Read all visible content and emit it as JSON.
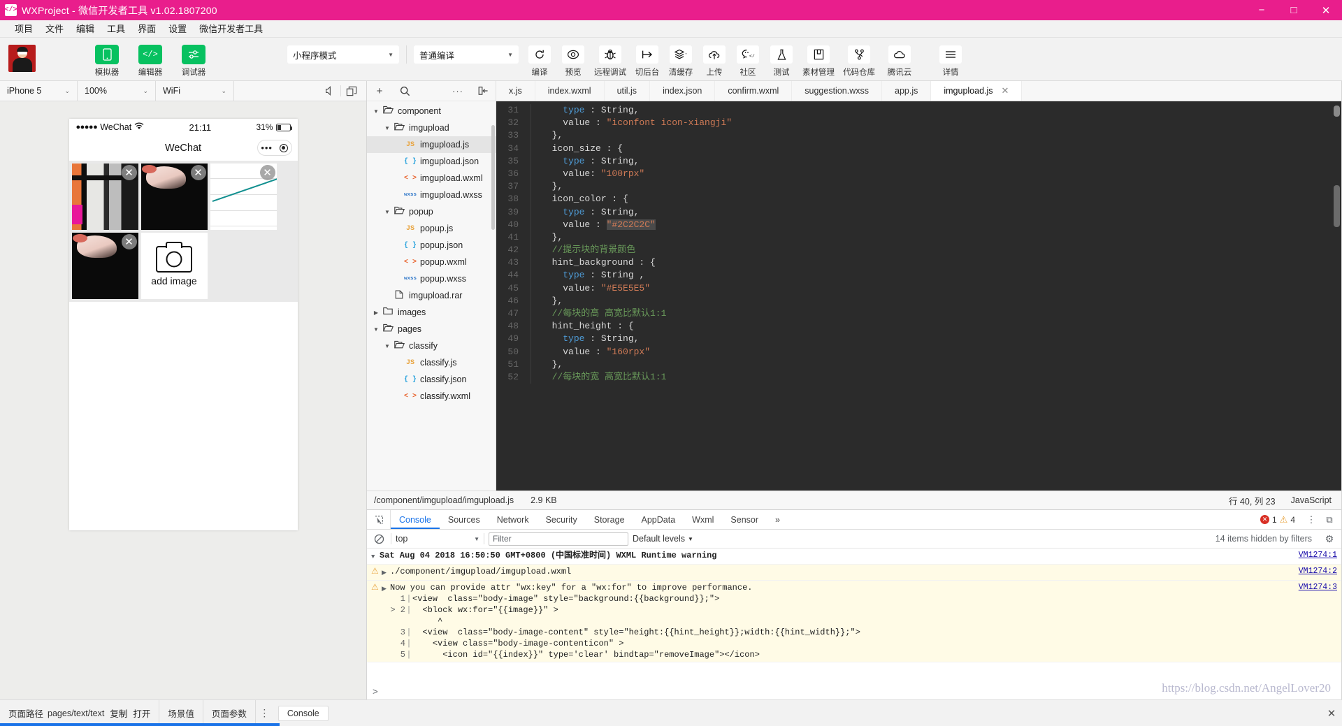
{
  "titlebar": {
    "logo": "code-icon",
    "title": "WXProject - 微信开发者工具 v1.02.1807200",
    "minimize": "−",
    "maximize": "□",
    "close": "✕"
  },
  "menubar": {
    "items": [
      "项目",
      "文件",
      "编辑",
      "工具",
      "界面",
      "设置",
      "微信开发者工具"
    ]
  },
  "toolbar": {
    "modes": [
      {
        "label": "模拟器",
        "icon": "phone-icon",
        "glyph": "▯"
      },
      {
        "label": "编辑器",
        "icon": "code-icon",
        "glyph": "</>"
      },
      {
        "label": "调试器",
        "icon": "debugger-icon",
        "glyph": "⚟"
      }
    ],
    "project_mode": "小程序模式",
    "compile_mode": "普通编译",
    "actions": [
      {
        "label": "编译",
        "icon": "refresh-icon",
        "glyph": "↻"
      },
      {
        "label": "预览",
        "icon": "eye-icon",
        "glyph": "◎"
      },
      {
        "label": "远程调试",
        "icon": "bug-icon",
        "glyph": "🐞"
      },
      {
        "label": "切后台",
        "icon": "background-icon",
        "glyph": "↦"
      },
      {
        "label": "清缓存",
        "icon": "layers-icon",
        "glyph": "≋",
        "caret": "▾"
      },
      {
        "label": "上传",
        "icon": "cloud-upload-icon",
        "glyph": "☁"
      },
      {
        "label": "社区",
        "icon": "community-icon",
        "glyph": "☺"
      },
      {
        "label": "测试",
        "icon": "flask-icon",
        "glyph": "⚗"
      },
      {
        "label": "素材管理",
        "icon": "assets-icon",
        "glyph": "▤"
      },
      {
        "label": "代码仓库",
        "icon": "repo-icon",
        "glyph": "⑂"
      },
      {
        "label": "腾讯云",
        "icon": "tencent-cloud-icon",
        "glyph": "☁"
      },
      {
        "label": "详情",
        "icon": "details-icon",
        "glyph": "☰"
      }
    ]
  },
  "simulator": {
    "device": "iPhone 5",
    "zoom": "100%",
    "network": "WiFi",
    "icons": [
      "volume-icon",
      "rotate-icon"
    ],
    "phone": {
      "signal_dots": "●●●●●",
      "carrier": "WeChat",
      "wifi": "⌁",
      "time": "21:11",
      "battery_text": "31%",
      "nav_title": "WeChat",
      "cap_dots": "•••",
      "add_image_label": "add image",
      "cells": [
        {
          "type": "ct",
          "close": "✕"
        },
        {
          "type": "dark",
          "close": "✕"
        },
        {
          "type": "chart",
          "close": "✕"
        },
        {
          "type": "dark",
          "close": "✕"
        },
        {
          "type": "add",
          "close": ""
        }
      ]
    }
  },
  "filetree": {
    "header_icons": [
      "add-icon",
      "search-icon",
      "more-icon",
      "collapse-icon"
    ],
    "add_glyph": "+",
    "search_glyph": "⌕",
    "more_glyph": "···",
    "collapse_glyph": "⇤",
    "nodes": [
      {
        "name": "component",
        "kind": "folder",
        "depth": 0,
        "arrow": "▼"
      },
      {
        "name": "imgupload",
        "kind": "folder",
        "depth": 1,
        "arrow": "▼"
      },
      {
        "name": "imgupload.js",
        "kind": "js",
        "depth": 2,
        "arrow": "",
        "selected": true
      },
      {
        "name": "imgupload.json",
        "kind": "json",
        "depth": 2,
        "arrow": ""
      },
      {
        "name": "imgupload.wxml",
        "kind": "wxml",
        "depth": 2,
        "arrow": ""
      },
      {
        "name": "imgupload.wxss",
        "kind": "wxss",
        "depth": 2,
        "arrow": ""
      },
      {
        "name": "popup",
        "kind": "folder",
        "depth": 1,
        "arrow": "▼"
      },
      {
        "name": "popup.js",
        "kind": "js",
        "depth": 2,
        "arrow": ""
      },
      {
        "name": "popup.json",
        "kind": "json",
        "depth": 2,
        "arrow": ""
      },
      {
        "name": "popup.wxml",
        "kind": "wxml",
        "depth": 2,
        "arrow": ""
      },
      {
        "name": "popup.wxss",
        "kind": "wxss",
        "depth": 2,
        "arrow": ""
      },
      {
        "name": "imgupload.rar",
        "kind": "file",
        "depth": 1,
        "arrow": ""
      },
      {
        "name": "images",
        "kind": "folder",
        "depth": 0,
        "arrow": "▶"
      },
      {
        "name": "pages",
        "kind": "folder",
        "depth": 0,
        "arrow": "▼"
      },
      {
        "name": "classify",
        "kind": "folder",
        "depth": 1,
        "arrow": "▼"
      },
      {
        "name": "classify.js",
        "kind": "js",
        "depth": 2,
        "arrow": ""
      },
      {
        "name": "classify.json",
        "kind": "json",
        "depth": 2,
        "arrow": ""
      },
      {
        "name": "classify.wxml",
        "kind": "wxml",
        "depth": 2,
        "arrow": ""
      }
    ],
    "icon_glyphs": {
      "folder_open": "🗁",
      "folder_closed": "🗀",
      "js": "JS",
      "json": "{ }",
      "wxml": "< >",
      "wxss": "wxss",
      "file": "🗋"
    }
  },
  "editor": {
    "tabs": [
      {
        "label": "x.js",
        "active": false
      },
      {
        "label": "index.wxml",
        "active": false
      },
      {
        "label": "util.js",
        "active": false
      },
      {
        "label": "index.json",
        "active": false
      },
      {
        "label": "confirm.wxml",
        "active": false
      },
      {
        "label": "suggestion.wxss",
        "active": false
      },
      {
        "label": "app.js",
        "active": false
      },
      {
        "label": "imgupload.js",
        "active": true,
        "close": "✕"
      }
    ],
    "code_lines": [
      {
        "n": 31,
        "segments": [
          {
            "t": "    ",
            "c": ""
          },
          {
            "t": "type",
            "c": "kw"
          },
          {
            "t": " : String,",
            "c": ""
          }
        ]
      },
      {
        "n": 32,
        "segments": [
          {
            "t": "    value : ",
            "c": ""
          },
          {
            "t": "\"iconfont icon-xiangji\"",
            "c": "str"
          }
        ]
      },
      {
        "n": 33,
        "segments": [
          {
            "t": "  },",
            "c": ""
          }
        ]
      },
      {
        "n": 34,
        "segments": [
          {
            "t": "  icon_size : {",
            "c": ""
          }
        ]
      },
      {
        "n": 35,
        "segments": [
          {
            "t": "    ",
            "c": ""
          },
          {
            "t": "type",
            "c": "kw"
          },
          {
            "t": " : String,",
            "c": ""
          }
        ]
      },
      {
        "n": 36,
        "segments": [
          {
            "t": "    value: ",
            "c": ""
          },
          {
            "t": "\"100rpx\"",
            "c": "str"
          }
        ]
      },
      {
        "n": 37,
        "segments": [
          {
            "t": "  },",
            "c": ""
          }
        ]
      },
      {
        "n": 38,
        "segments": [
          {
            "t": "  icon_color : {",
            "c": ""
          }
        ]
      },
      {
        "n": 39,
        "segments": [
          {
            "t": "    ",
            "c": ""
          },
          {
            "t": "type",
            "c": "kw"
          },
          {
            "t": " : String,",
            "c": ""
          }
        ]
      },
      {
        "n": 40,
        "segments": [
          {
            "t": "    value : ",
            "c": ""
          },
          {
            "t": "\"#2C2C2C\"",
            "c": "str hl"
          }
        ]
      },
      {
        "n": 41,
        "segments": [
          {
            "t": "  },",
            "c": ""
          }
        ]
      },
      {
        "n": 42,
        "segments": [
          {
            "t": "  //提示块的背景颜色",
            "c": "cmt"
          }
        ]
      },
      {
        "n": 43,
        "segments": [
          {
            "t": "  hint_background : {",
            "c": ""
          }
        ]
      },
      {
        "n": 44,
        "segments": [
          {
            "t": "    ",
            "c": ""
          },
          {
            "t": "type",
            "c": "kw"
          },
          {
            "t": " : String ,",
            "c": ""
          }
        ]
      },
      {
        "n": 45,
        "segments": [
          {
            "t": "    value: ",
            "c": ""
          },
          {
            "t": "\"#E5E5E5\"",
            "c": "str"
          }
        ]
      },
      {
        "n": 46,
        "segments": [
          {
            "t": "  },",
            "c": ""
          }
        ]
      },
      {
        "n": 47,
        "segments": [
          {
            "t": "  //每块的高 高宽比默认1:1",
            "c": "cmt"
          }
        ]
      },
      {
        "n": 48,
        "segments": [
          {
            "t": "  hint_height : {",
            "c": ""
          }
        ]
      },
      {
        "n": 49,
        "segments": [
          {
            "t": "    ",
            "c": ""
          },
          {
            "t": "type",
            "c": "kw"
          },
          {
            "t": " : String,",
            "c": ""
          }
        ]
      },
      {
        "n": 50,
        "segments": [
          {
            "t": "    value : ",
            "c": ""
          },
          {
            "t": "\"160rpx\"",
            "c": "str"
          }
        ]
      },
      {
        "n": 51,
        "segments": [
          {
            "t": "  },",
            "c": ""
          }
        ]
      },
      {
        "n": 52,
        "segments": [
          {
            "t": "  //每块的宽 高宽比默认1:1",
            "c": "cmt"
          }
        ]
      }
    ],
    "status": {
      "path": "/component/imgupload/imgupload.js",
      "size": "2.9 KB",
      "cursor": "行 40, 列 23",
      "language": "JavaScript"
    }
  },
  "devtools": {
    "inspect_icon": "cursor-select-icon",
    "tabs": [
      "Console",
      "Sources",
      "Network",
      "Security",
      "Storage",
      "AppData",
      "Wxml",
      "Sensor"
    ],
    "active_tab": "Console",
    "overflow": "»",
    "error_count": "1",
    "warning_count": "4",
    "warning_glyph": "⚠",
    "menu_glyph": "⋮",
    "dock_glyph": "⧉",
    "clear_glyph": "⃠",
    "context": "top",
    "filter_placeholder": "Filter",
    "levels": "Default levels",
    "hidden_text": "14 items hidden by filters",
    "settings_glyph": "⚙",
    "logs": [
      {
        "kind": "group",
        "arrow": "▼",
        "text": "Sat Aug 04 2018 16:50:50 GMT+0800 (中国标准时间) WXML Runtime warning",
        "vm": "VM1274:1"
      },
      {
        "kind": "warn",
        "arrow": "▶",
        "text": "./component/imgupload/imgupload.wxml",
        "vm": "VM1274:2"
      },
      {
        "kind": "warn",
        "arrow": "▶",
        "text": "Now you can provide attr \"wx:key\" for a \"wx:for\" to improve performance.",
        "vm": "VM1274:3",
        "code": [
          {
            "n": "1",
            "mark": "",
            "t": "<view  class=\"body-image\" style=\"background:{{background}};\">"
          },
          {
            "n": "2",
            "mark": "> ",
            "t": "  <block wx:for=\"{{image}}\" >"
          },
          {
            "n": "",
            "mark": "",
            "t": "     ^"
          },
          {
            "n": "3",
            "mark": "",
            "t": "  <view  class=\"body-image-content\" style=\"height:{{hint_height}};width:{{hint_width}};\">"
          },
          {
            "n": "4",
            "mark": "",
            "t": "    <view class=\"body-image-contenticon\" >"
          },
          {
            "n": "5",
            "mark": "",
            "t": "      <icon id=\"{{index}}\" type='clear' bindtap=\"removeImage\"></icon>"
          }
        ]
      }
    ],
    "prompt": ">"
  },
  "bottombar": {
    "path_label": "页面路径",
    "path_value": "pages/text/text",
    "copy": "复制",
    "open": "打开",
    "scene": "场景值",
    "params": "页面参数",
    "dots": "⋮",
    "console": "Console",
    "close": "✕",
    "watermark": "https://blog.csdn.net/AngelLover20"
  }
}
